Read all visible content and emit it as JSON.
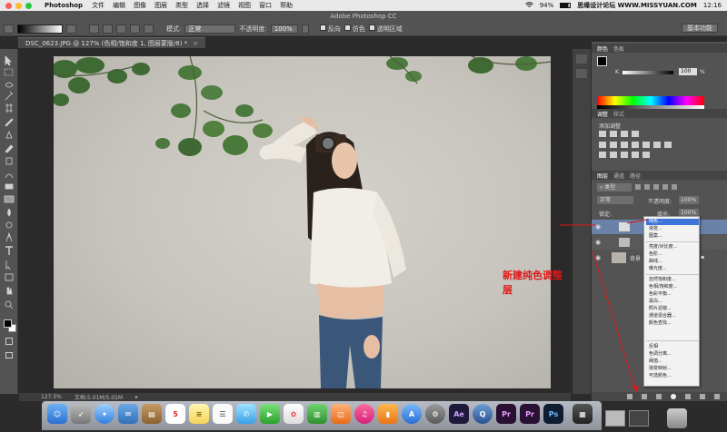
{
  "menubar": {
    "app_name": "Photoshop",
    "items": [
      "文件",
      "编辑",
      "图像",
      "图层",
      "类型",
      "选择",
      "滤镜",
      "视图",
      "窗口",
      "帮助"
    ],
    "battery": "94%",
    "clock": "12:16"
  },
  "options": {
    "app_title": "Adobe Photoshop CC",
    "mode_label": "模式:",
    "mode_value": "正常",
    "opacity_label": "不透明度:",
    "opacity_value": "100%",
    "reverse_label": "反向",
    "dither_label": "仿色",
    "transparency_label": "透明区域",
    "workspace": "基本功能"
  },
  "document": {
    "tab_title": "DSC_0623.JPG @ 127% (色相/饱和度 1, 图层蒙版/8) *",
    "zoom": "127.5%",
    "doc_size": "文档:5.01M/5.01M"
  },
  "annotation": "新建纯色调整层",
  "watermark": "思缘设计论坛 WWW.MISSYUAN.COM",
  "color_panel": {
    "tabs": [
      "颜色",
      "色板"
    ],
    "k_label": "K",
    "k_value": "100",
    "k_unit": "%"
  },
  "adjust_panel": {
    "tabs": [
      "调整",
      "样式"
    ],
    "title": "添加调整"
  },
  "layers_panel": {
    "tabs": [
      "图层",
      "通道",
      "路径"
    ],
    "kind_filter": "类型",
    "blend_mode": "正常",
    "opacity_label": "不透明度:",
    "opacity_value": "100%",
    "lock_label": "锁定:",
    "fill_label": "填充:",
    "fill_value": "100%",
    "background_layer": "背景"
  },
  "context_menu": {
    "items": [
      {
        "label": "纯色...",
        "highlight": true
      },
      {
        "label": "渐变..."
      },
      {
        "label": "图案..."
      },
      {
        "label": "亮度/对比度..."
      },
      {
        "label": "色阶..."
      },
      {
        "label": "曲线..."
      },
      {
        "label": "曝光度..."
      },
      {
        "label": "自然饱和度..."
      },
      {
        "label": "色相/饱和度..."
      },
      {
        "label": "色彩平衡..."
      },
      {
        "label": "黑白..."
      },
      {
        "label": "照片滤镜..."
      },
      {
        "label": "通道混合器..."
      },
      {
        "label": "颜色查找..."
      },
      {
        "label": "反相"
      },
      {
        "label": "色调分离..."
      },
      {
        "label": "阈值..."
      },
      {
        "label": "渐变映射..."
      },
      {
        "label": "可选颜色..."
      }
    ]
  },
  "dock": {
    "calendar_day": "5",
    "ae": "Ae",
    "pr": "Pr",
    "ps": "Ps"
  }
}
